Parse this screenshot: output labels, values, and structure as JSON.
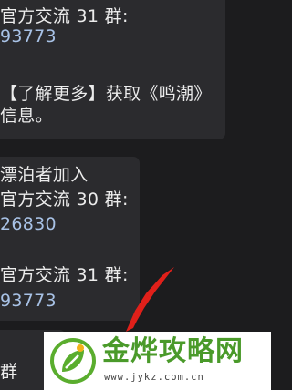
{
  "chat": {
    "bubble1": {
      "line1": "官方交流 31 群:",
      "line2": "93773",
      "line3": "【了解更多】获取《鸣潮》",
      "line4": "信息。"
    },
    "bubble2": {
      "line1": "漂泊者加入",
      "line2": "官方交流 30 群:",
      "line3": "26830",
      "line4": "官方交流 31 群:",
      "line5": "93773"
    },
    "bubble3": {
      "line1": "群"
    }
  },
  "watermark": {
    "title": "金烨攻略网",
    "url": "www.jykz.com.cn"
  },
  "colors": {
    "background": "#1c1c1e",
    "bubble": "#2b2b2e",
    "text": "#ececec",
    "number_link": "#a8c2e6",
    "arrow": "#e0201a",
    "watermark_green": "#4a9a2a"
  }
}
